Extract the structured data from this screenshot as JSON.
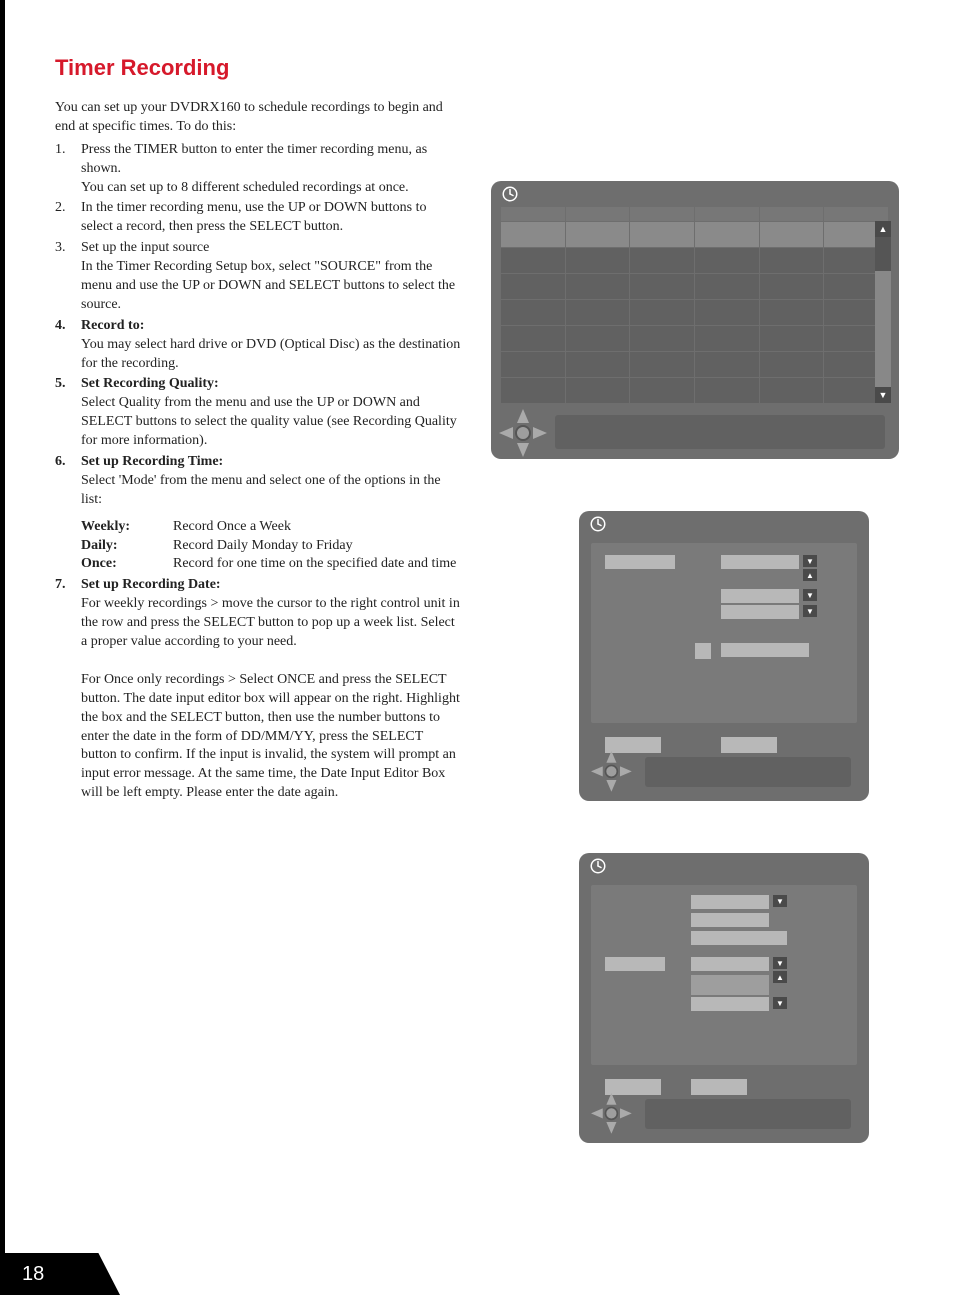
{
  "page_number": "18",
  "title": "Timer Recording",
  "intro": "You can set up your DVDRX160 to schedule recordings to begin and end at specific times. To do this:",
  "steps": [
    {
      "n": "1.",
      "text": "Press the TIMER button to enter the timer recording menu, as shown.",
      "extra": "You can set up to 8 different scheduled recordings at once."
    },
    {
      "n": "2.",
      "text": "In the timer recording menu, use the UP or DOWN buttons to select a record, then press the SELECT button."
    },
    {
      "n": "3.",
      "text": "Set up the input source",
      "extra": "In the Timer Recording Setup box, select \"SOURCE\" from the menu and use the UP or DOWN and SELECT buttons to select the source."
    },
    {
      "n": "4.",
      "bold_lead": "Record to:",
      "extra": "You may select hard drive or DVD (Optical Disc) as the destination for the recording."
    },
    {
      "n": "5.",
      "bold_lead": "Set Recording Quality:",
      "extra": "Select Quality from the menu and use the UP or DOWN and SELECT buttons to select the quality value (see Recording Quality for more information)."
    },
    {
      "n": "6.",
      "bold_lead": "Set up Recording Time:",
      "extra": "Select 'Mode' from the menu and select one of the options in the list:"
    },
    {
      "n": "7.",
      "bold_lead": "Set up Recording Date:",
      "extra": "For weekly recordings > move the cursor to the right control unit in the row and press the SELECT button to pop up a week list. Select a proper value according to your need.",
      "extra2": "For Once only recordings > Select ONCE and press the SELECT button. The date input editor box will appear on the right. Highlight the box and the SELECT button, then use the number buttons to enter the date in the form of DD/MM/YY, press the SELECT button to confirm. If the input is invalid, the system will prompt an input error message. At the same time, the Date Input Editor Box will be left empty. Please enter the date again."
    }
  ],
  "modes": [
    {
      "label": "Weekly:",
      "desc": "Record Once a Week"
    },
    {
      "label": "Daily:",
      "desc": "Record Daily Monday to Friday"
    },
    {
      "label": "Once:",
      "desc": "Record for one time on the specified date and time"
    }
  ],
  "icons": {
    "clock": "clock-icon",
    "up": "▲",
    "down": "▼"
  }
}
